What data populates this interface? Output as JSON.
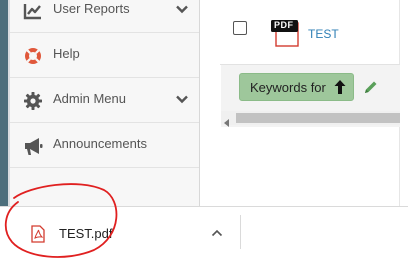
{
  "sidebar": {
    "items": [
      {
        "label": "User Reports",
        "icon": "line-chart-icon",
        "has_chevron": true
      },
      {
        "label": "Help",
        "icon": "lifebuoy-icon",
        "has_chevron": false
      },
      {
        "label": "Admin Menu",
        "icon": "gear-icon",
        "has_chevron": true
      },
      {
        "label": "Announcements",
        "icon": "megaphone-icon",
        "has_chevron": false
      }
    ]
  },
  "content": {
    "file_row": {
      "file_type_badge": "PDF",
      "file_name": "TEST"
    },
    "keywords_button_label": "Keywords for"
  },
  "download_bar": {
    "file_name": "TEST.pdf"
  },
  "colors": {
    "link": "#2f7fb5",
    "keywords_button": "#9ec79b",
    "pencil": "#5aa05a",
    "annotation_circle": "#e02020",
    "pdf_red": "#d33b2f"
  }
}
